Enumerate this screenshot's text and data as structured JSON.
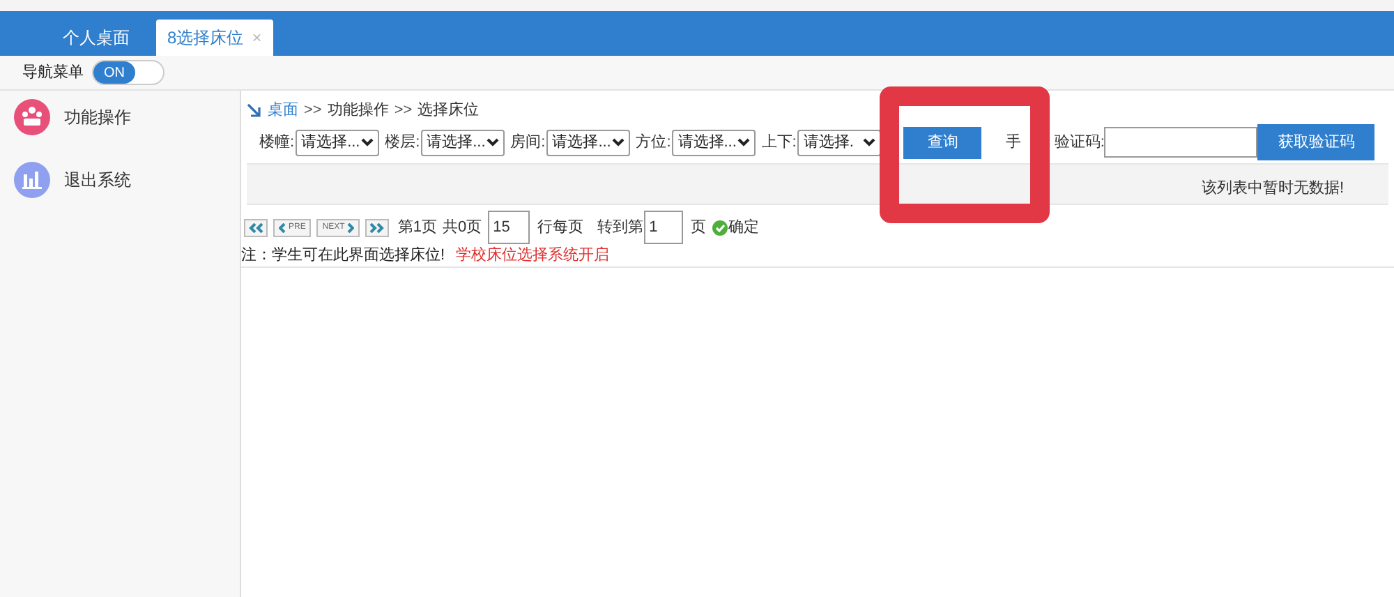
{
  "top_tabs": [
    {
      "label": "个人桌面",
      "selected": false
    },
    {
      "label": "8选择床位",
      "selected": true,
      "close": "×"
    }
  ],
  "nav_toggle": {
    "label": "导航菜单",
    "on": true,
    "text": "ON"
  },
  "sidebar": {
    "items": [
      {
        "label": "功能操作",
        "kind": "operations",
        "color": "#e8507a"
      },
      {
        "label": "退出系统",
        "kind": "exit",
        "color": "#8fa0f0"
      }
    ]
  },
  "breadcrumb": [
    {
      "text": "桌面",
      "kind": "link"
    },
    {
      "text": ">>",
      "kind": "separator"
    },
    {
      "text": "功能操作",
      "kind": "crumb"
    },
    {
      "text": ">>",
      "kind": "separator"
    },
    {
      "text": "选择床位",
      "kind": "crumb"
    }
  ],
  "filters": [
    {
      "label": "楼幢:",
      "value": "请选择..."
    },
    {
      "label": "楼层:",
      "value": "请选择..."
    },
    {
      "label": "房间:",
      "value": "请选择..."
    },
    {
      "label": "方位:",
      "value": "请选择..."
    },
    {
      "label": "上下:",
      "value": "请选择."
    }
  ],
  "query_button": "查询",
  "phone_code": {
    "label_parts": [
      "手",
      "验证码:"
    ],
    "button": "获取验证码"
  },
  "table": {
    "empty_message": "该列表中暂时无数据!"
  },
  "pagination": {
    "prev": "PRE",
    "next": "NEXT",
    "current": "第1页",
    "total": "共0页",
    "page_size": "15",
    "page_size_label": "行每页",
    "goto_label": "转到第",
    "goto_value": "1",
    "page_unit": "页",
    "confirm": "确定"
  },
  "note": {
    "text": "注：学生可在此界面选择床位!",
    "status": "学校床位选择系统开启"
  },
  "highlight_frame": true
}
